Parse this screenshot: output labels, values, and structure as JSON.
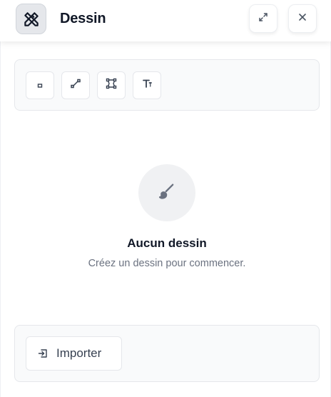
{
  "header": {
    "title": "Dessin",
    "app_icon": "drafting-compass-icon",
    "expand_icon": "expand-icon",
    "close_icon": "close-icon"
  },
  "toolbar": {
    "tools": [
      {
        "icon": "rectangle-tool-icon"
      },
      {
        "icon": "line-tool-icon"
      },
      {
        "icon": "polygon-tool-icon"
      },
      {
        "icon": "text-tool-icon"
      }
    ]
  },
  "empty_state": {
    "icon": "brush-icon",
    "title": "Aucun dessin",
    "subtitle": "Créez un dessin pour commencer."
  },
  "footer": {
    "import_label": "Importer",
    "import_icon": "import-icon"
  },
  "colors": {
    "text_primary": "#111827",
    "text_muted": "#6b7280",
    "panel_bg": "#f9fafb",
    "border": "#e5e7eb"
  }
}
